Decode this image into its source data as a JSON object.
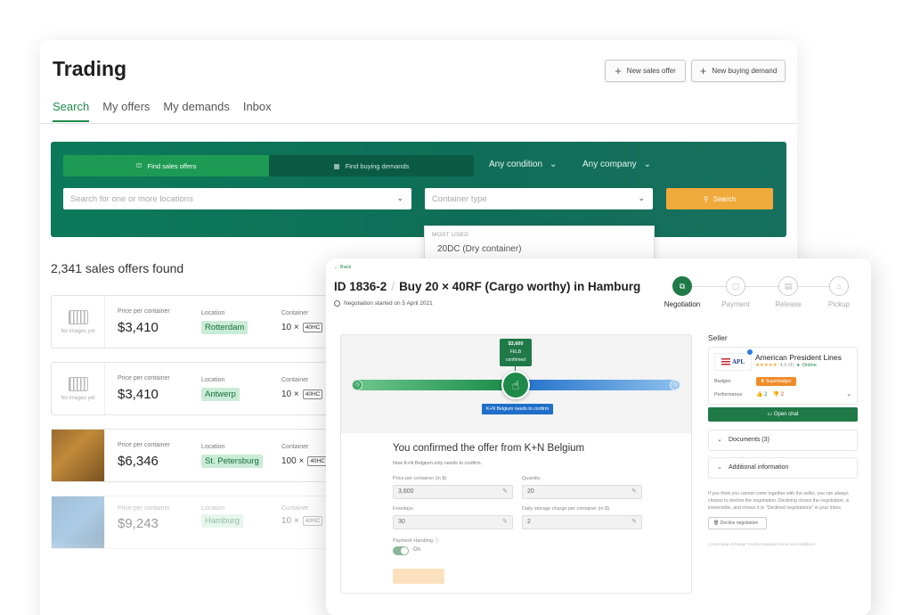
{
  "trading": {
    "title": "Trading",
    "new_sales_offer": "New sales offer",
    "new_buying_demand": "New buying demand",
    "tabs": [
      "Search",
      "My offers",
      "My demands",
      "Inbox"
    ],
    "search": {
      "find_sales_offers": "Find sales offers",
      "find_buying_demands": "Find buying demands",
      "condition": "Any condition",
      "company": "Any company",
      "location_placeholder": "Search for one or more locations",
      "container_type_placeholder": "Container type",
      "search_button": "Search",
      "dropdown_header": "MOST USED",
      "dropdown_option": "20DC (Dry container)"
    },
    "results_count": "2,341 sales offers found",
    "labels": {
      "price": "Price per container",
      "location": "Location",
      "container": "Container",
      "no_images": "No images yet"
    },
    "offers": [
      {
        "price": "$3,410",
        "location": "Rotterdam",
        "qty": "10 ×",
        "type": "40HC"
      },
      {
        "price": "$3,410",
        "location": "Antwerp",
        "qty": "10 ×",
        "type": "40HC"
      },
      {
        "price": "$6,346",
        "location": "St. Petersburg",
        "qty": "100 ×",
        "type": "40HC"
      },
      {
        "price": "$9,243",
        "location": "Hamburg",
        "qty": "10 ×",
        "type": "40HC"
      }
    ]
  },
  "negotiation": {
    "back": "Back",
    "id": "ID 1836-2",
    "title": "Buy 20 × 40RF (Cargo worthy) in Hamburg",
    "started": "Negotiation started on 5 April 2021",
    "steps": [
      "Negotiation",
      "Payment",
      "Release",
      "Pickup"
    ],
    "flag_price": "$3,600",
    "flag_fee": "FELB",
    "flag_status": "confirmed",
    "blue_tag": "K+N Belgium needs to confirm",
    "confirmed_title": "You confirmed the offer from K+N Belgium",
    "confirmed_sub": "Now K+N Belgium only needs to confirm.",
    "fields": {
      "price_label": "Price per container (in $)",
      "price_value": "3,600",
      "quantity_label": "Quantity",
      "quantity_value": "20",
      "freedays_label": "Freedays",
      "freedays_value": "30",
      "storage_label": "Daily storage charge per container (in $)",
      "storage_value": "2",
      "payment_label": "Payment Handling",
      "payment_value": "On"
    }
  },
  "seller": {
    "label": "Seller",
    "logo": "APL",
    "name": "American President Lines",
    "rating": "4.9 (4)",
    "status": "Online",
    "badges_label": "Badges",
    "badge": "Superbadger",
    "performance_label": "Performance",
    "thumbs_up": "2",
    "thumbs_down": "2",
    "open_chat": "Open chat",
    "documents": "Documents (3)",
    "additional": "Additional information",
    "decline_text": "If you think you cannot come together with the seller, you can always choose to decline the negotiation. Declining closes the negotiation, is irreversible, and moves it to \"Declined negotiations\" in your inbox.",
    "decline_button": "Decline negotiation",
    "download_link": "Download xChange Trading standard terms and conditions"
  }
}
